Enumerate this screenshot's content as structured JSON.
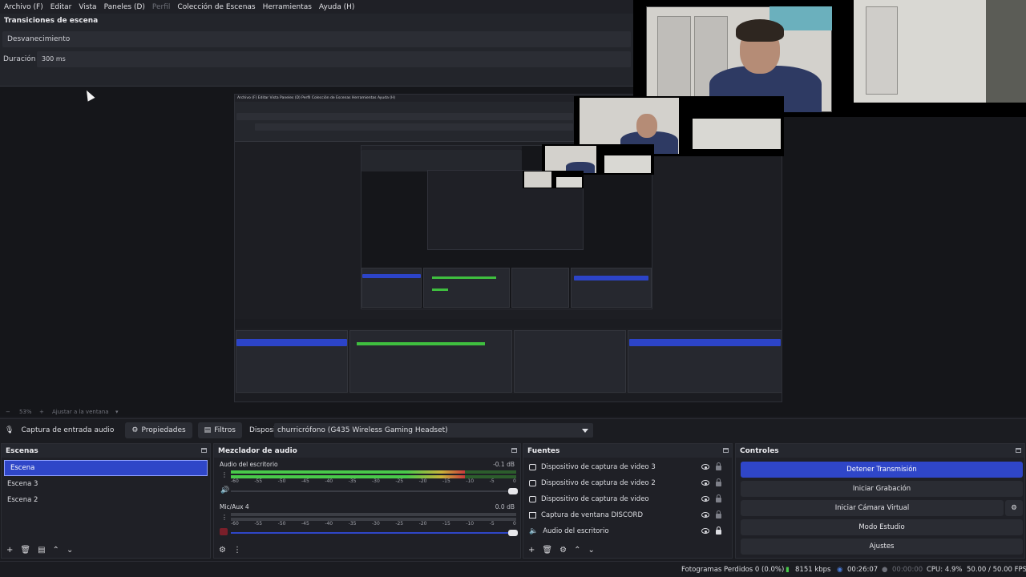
{
  "menubar": {
    "items": [
      "Archivo (F)",
      "Editar",
      "Vista",
      "Paneles (D)",
      "Perfil",
      "Colección de Escenas",
      "Herramientas",
      "Ayuda (H)"
    ]
  },
  "transitions": {
    "title": "Transiciones de escena",
    "selected": "Desvanecimiento",
    "duration_label": "Duración",
    "duration_value": "300 ms"
  },
  "zoom": {
    "value": "53%",
    "fit_label": "Ajustar a la ventana"
  },
  "source_toolbar": {
    "source_name": "Captura de entrada audio",
    "properties_label": "Propiedades",
    "filters_label": "Filtros",
    "device_label": "Dispositivo",
    "device_value": "churricrófono (G435 Wireless Gaming Headset)"
  },
  "scenes": {
    "title": "Escenas",
    "items": [
      "Escena",
      "Escena 3",
      "Escena 2"
    ],
    "selected_index": 0
  },
  "mixer": {
    "title": "Mezclador de audio",
    "channels": [
      {
        "name": "Audio del escritorio",
        "db": "-0.1 dB",
        "level": 0.82
      },
      {
        "name": "Mic/Aux 4",
        "db": "0.0 dB",
        "level": 0.0
      }
    ],
    "tick_labels": [
      "-60",
      "-55",
      "-50",
      "-45",
      "-40",
      "-35",
      "-30",
      "-25",
      "-20",
      "-15",
      "-10",
      "-5",
      "0"
    ]
  },
  "sources": {
    "title": "Fuentes",
    "items": [
      {
        "name": "Dispositivo de captura de video 3",
        "icon": "camera-icon",
        "locked": false
      },
      {
        "name": "Dispositivo de captura de video 2",
        "icon": "camera-icon",
        "locked": false
      },
      {
        "name": "Dispositivo de captura de video",
        "icon": "camera-icon",
        "locked": false
      },
      {
        "name": "Captura de ventana DISCORD",
        "icon": "window-icon",
        "locked": false
      },
      {
        "name": "Audio del escritorio",
        "icon": "speaker-icon",
        "locked": true
      }
    ]
  },
  "controls": {
    "title": "Controles",
    "stop_stream": "Detener Transmisión",
    "start_recording": "Iniciar Grabación",
    "start_virtual_cam": "Iniciar Cámara Virtual",
    "studio_mode": "Modo Estudio",
    "settings": "Ajustes"
  },
  "statusbar": {
    "dropped_frames": "Fotogramas Perdidos 0 (0.0%)",
    "bitrate": "8151 kbps",
    "stream_time": "00:26:07",
    "record_time": "00:00:00",
    "cpu": "CPU: 4.9%",
    "fps": "50.00 / 50.00 FPS"
  },
  "colors": {
    "accent": "#2f46c8",
    "meter_green": "#49c94a",
    "meter_yellow": "#c9b33a",
    "meter_red": "#c93a3a"
  }
}
